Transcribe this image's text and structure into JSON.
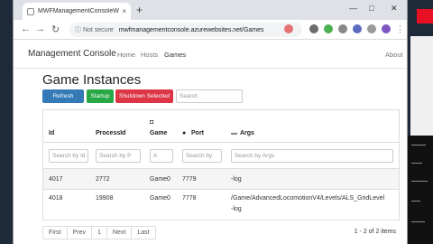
{
  "browser": {
    "tab_title": "MWFManagementConsoleWebApp",
    "tab_close": "×",
    "new_tab": "+",
    "security": "Not secure",
    "url": "mwfmanagementconsole.azurewebsites.net/Games",
    "win_min": "—",
    "win_max": "□",
    "win_close": "✕"
  },
  "nav": {
    "brand": "Management Console",
    "home": "Home",
    "hosts": "Hosts",
    "games": "Games",
    "about": "About"
  },
  "page": {
    "title": "Game Instances",
    "refresh": "Refresh",
    "startup": "Startup",
    "shutdown": "Shutdown Selected",
    "search_placeholder": "Search"
  },
  "table": {
    "headers": {
      "id": "Id",
      "process": "ProcessId",
      "game": "Game",
      "port": "Port",
      "args": "Args"
    },
    "filters": {
      "id": "Search by Id",
      "process": "Search by P",
      "game": "A",
      "port": "Search by",
      "args": "Search by Args"
    },
    "rows": [
      {
        "id": "4017",
        "process": "2772",
        "game": "Game0",
        "port": "7779",
        "args": "-log"
      },
      {
        "id": "4018",
        "process": "19908",
        "game": "Game0",
        "port": "7778",
        "args_line1": "/Game/AdvancedLocomotionV4/Levels/ALS_GridLevel",
        "args_line2": "-log"
      }
    ]
  },
  "pager": {
    "first": "First",
    "prev": "Prev",
    "page1": "1",
    "next": "Next",
    "last": "Last",
    "info": "1 - 2 of 2 items"
  },
  "colors": {
    "refresh": "#337ab7",
    "startup": "#28a745",
    "shutdown": "#dc3545"
  }
}
